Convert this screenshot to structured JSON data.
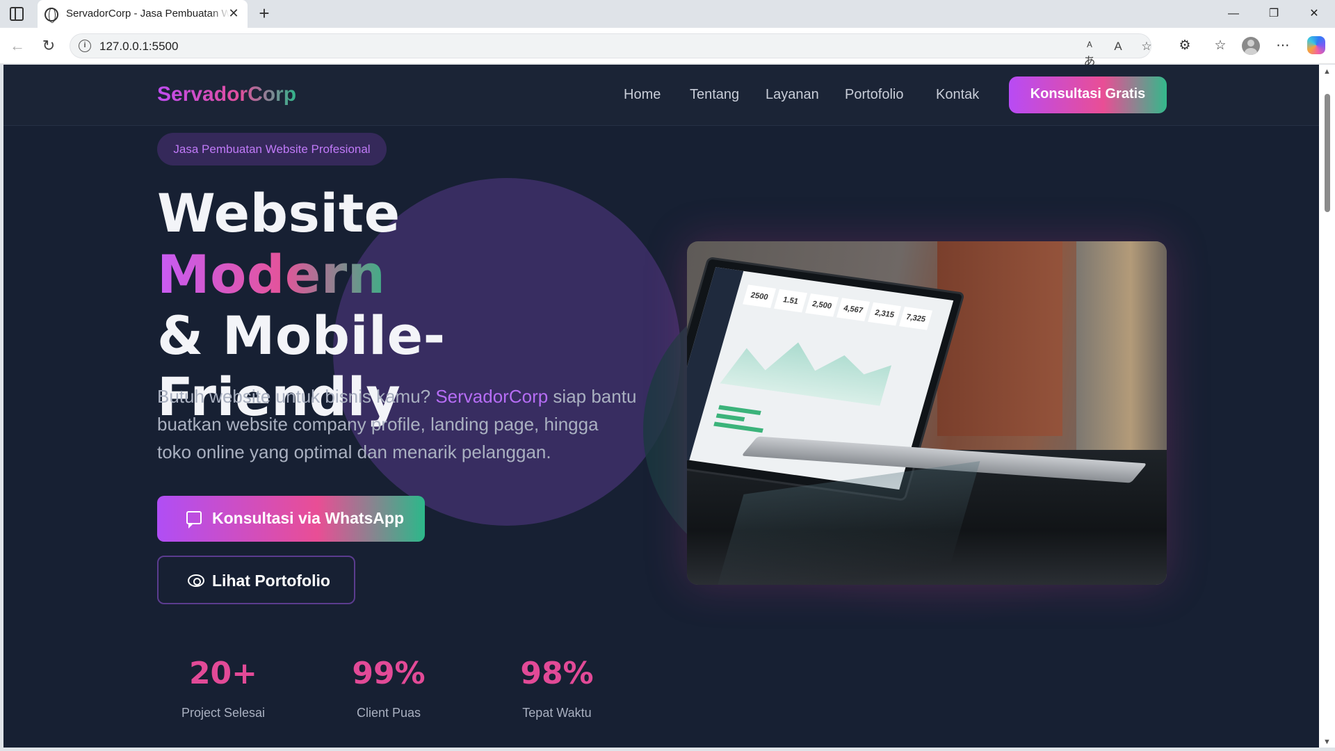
{
  "browser": {
    "tab_title": "ServadorCorp - Jasa Pembuatan Website",
    "tab_close": "✕",
    "new_tab": "+",
    "url": "127.0.0.1:5500",
    "window_controls": [
      "—",
      "❐",
      "✕"
    ]
  },
  "header": {
    "logo": "ServadorCorp",
    "nav": [
      "Home",
      "Tentang",
      "Layanan",
      "Portofolio",
      "Kontak"
    ],
    "cta": "Konsultasi Gratis"
  },
  "hero": {
    "badge": "Jasa Pembuatan Website Profesional",
    "title_part1": "Website ",
    "title_highlight": "Modern",
    "title_part2": "& Mobile-Friendly",
    "desc_before": "Butuh website untuk bisnis kamu? ",
    "desc_brand": "ServadorCorp",
    "desc_after": " siap bantu buatkan website company profile, landing page, hingga toko online yang optimal dan menarik pelanggan.",
    "primary_button": "Konsultasi via WhatsApp",
    "secondary_button": "Lihat Portofolio",
    "image_stats": [
      "2500",
      "1.51",
      "2,500",
      "4,567",
      "2,315",
      "7,325"
    ]
  },
  "stats": [
    {
      "value": "20+",
      "label": "Project Selesai"
    },
    {
      "value": "99%",
      "label": "Client Puas"
    },
    {
      "value": "98%",
      "label": "Tepat Waktu"
    }
  ],
  "colors": {
    "page_bg": "#172033",
    "accent_purple": "#b84bf5",
    "accent_pink": "#e94e95",
    "accent_green": "#33b98b"
  }
}
